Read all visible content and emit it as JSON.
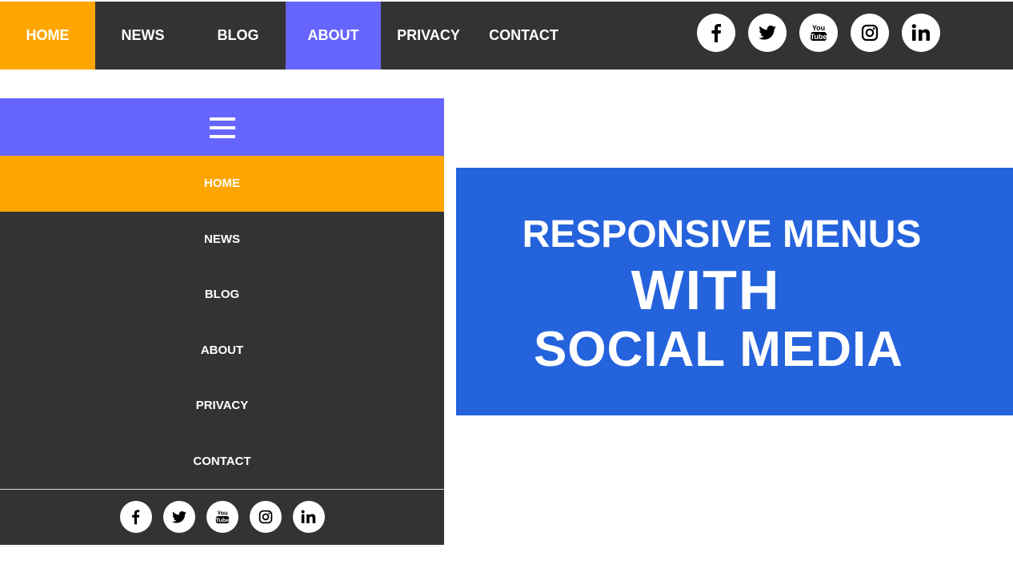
{
  "top_nav": {
    "items": [
      {
        "label": "HOME",
        "state": "active"
      },
      {
        "label": "NEWS",
        "state": "normal"
      },
      {
        "label": "BLOG",
        "state": "normal"
      },
      {
        "label": "ABOUT",
        "state": "hover"
      },
      {
        "label": "PRIVACY",
        "state": "normal"
      },
      {
        "label": "CONTACT",
        "state": "normal"
      }
    ],
    "social": [
      "facebook-icon",
      "twitter-icon",
      "youtube-icon",
      "instagram-icon",
      "linkedin-icon"
    ]
  },
  "mobile_menu": {
    "toggle_icon": "hamburger-icon",
    "items": [
      {
        "label": "HOME",
        "state": "active"
      },
      {
        "label": "NEWS",
        "state": "normal"
      },
      {
        "label": "BLOG",
        "state": "normal"
      },
      {
        "label": "ABOUT",
        "state": "normal"
      },
      {
        "label": "PRIVACY",
        "state": "normal"
      },
      {
        "label": "CONTACT",
        "state": "normal"
      }
    ],
    "social": [
      "facebook-icon",
      "twitter-icon",
      "youtube-icon",
      "instagram-icon",
      "linkedin-icon"
    ]
  },
  "banner": {
    "line1": "RESPONSIVE MENUS",
    "line2": "WITH",
    "line3": "SOCIAL MEDIA"
  },
  "colors": {
    "nav_bg": "#333333",
    "active": "#ffa500",
    "hover": "#6666ff",
    "banner": "#2563dd",
    "text": "#ffffff"
  }
}
